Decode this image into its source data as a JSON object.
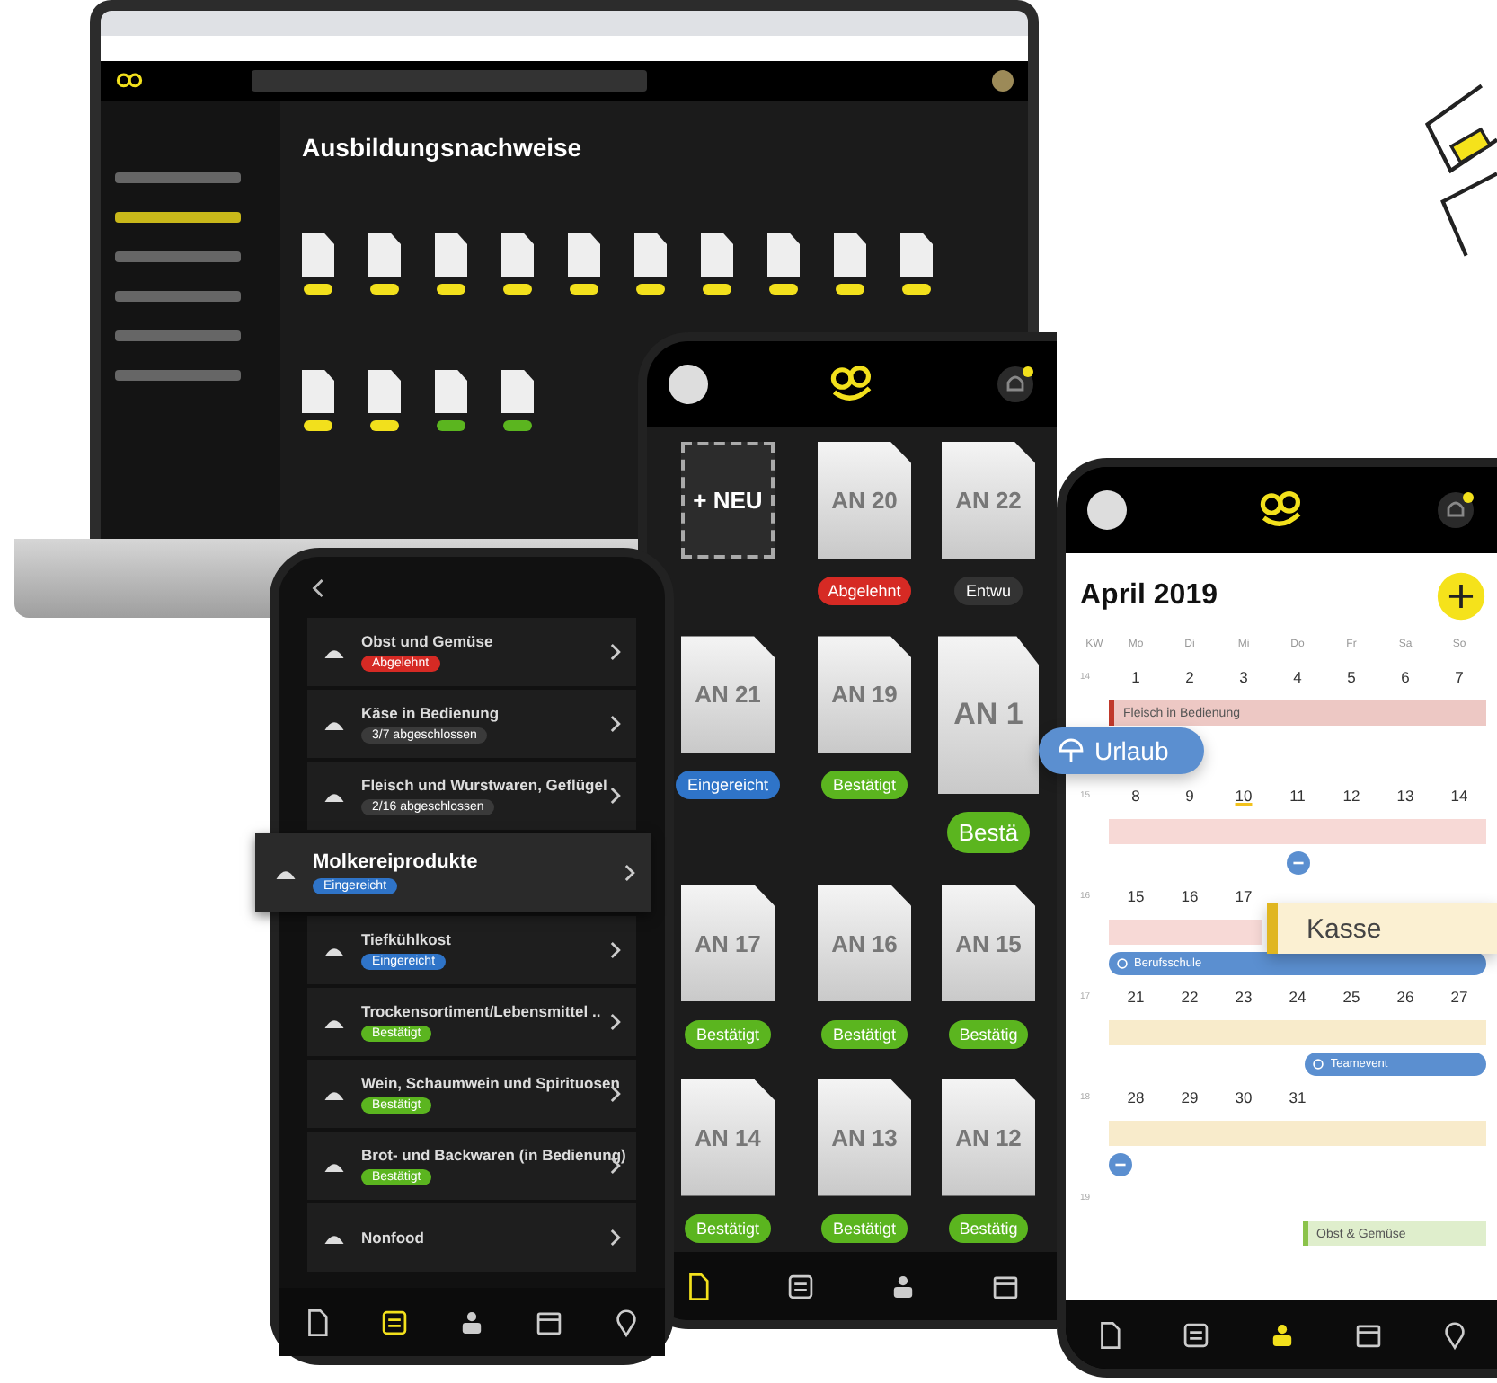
{
  "laptop": {
    "page_title": "Ausbildungsnachweise",
    "sidebar": [
      {
        "selected": false
      },
      {
        "selected": true
      },
      {
        "selected": false
      },
      {
        "selected": false
      },
      {
        "selected": false
      },
      {
        "selected": false
      }
    ],
    "sections": [
      {
        "docs": [
          {
            "color": "#f2e01c"
          },
          {
            "color": "#f2e01c"
          },
          {
            "color": "#f2e01c"
          },
          {
            "color": "#f2e01c"
          },
          {
            "color": "#f2e01c"
          },
          {
            "color": "#f2e01c"
          },
          {
            "color": "#f2e01c"
          },
          {
            "color": "#f2e01c"
          },
          {
            "color": "#f2e01c"
          },
          {
            "color": "#f2e01c"
          }
        ]
      },
      {
        "docs": [
          {
            "color": "#f2e01c"
          },
          {
            "color": "#f2e01c"
          },
          {
            "color": "#5bb51f"
          },
          {
            "color": "#5bb51f"
          }
        ]
      }
    ]
  },
  "list_phone": {
    "items": [
      {
        "title": "Obst und Gemüse",
        "badge": "Abgelehnt",
        "color": "#d62a24",
        "highlighted": false
      },
      {
        "title": "Käse in Bedienung",
        "badge": "3/7 abgeschlossen",
        "color": "#3a3a3a",
        "highlighted": false
      },
      {
        "title": "Fleisch und Wurstwaren, Geflügel",
        "badge": "2/16 abgeschlossen",
        "color": "#3a3a3a",
        "highlighted": false
      },
      {
        "title": "Molkereiprodukte",
        "badge": "Eingereicht",
        "color": "#2f74c8",
        "highlighted": true
      },
      {
        "title": "Tiefkühlkost",
        "badge": "Eingereicht",
        "color": "#2f74c8",
        "highlighted": false
      },
      {
        "title": "Trockensortiment/Lebensmittel ..",
        "badge": "Bestätigt",
        "color": "#5bb51f",
        "highlighted": false
      },
      {
        "title": "Wein, Schaumwein und Spirituosen",
        "badge": "Bestätigt",
        "color": "#5bb51f",
        "highlighted": false
      },
      {
        "title": "Brot- und Backwaren (in Bedienung)",
        "badge": "Bestätigt",
        "color": "#5bb51f",
        "highlighted": false
      },
      {
        "title": "Nonfood",
        "highlighted": false
      }
    ],
    "nav": [
      {
        "kind": "doc",
        "selected": false
      },
      {
        "kind": "list",
        "selected": true
      },
      {
        "kind": "people",
        "selected": false
      },
      {
        "kind": "calendar",
        "selected": false
      },
      {
        "kind": "pin",
        "selected": false
      }
    ]
  },
  "docs_phone": {
    "cards": [
      {
        "kind": "new",
        "label": "+ NEU"
      },
      {
        "kind": "doc",
        "label": "AN 20",
        "badge": "Abgelehnt",
        "color": "#d62a24",
        "enlarged": false
      },
      {
        "kind": "doc",
        "label": "AN 22",
        "badge": "Entwu",
        "color": "#333333",
        "enlarged": false
      },
      {
        "kind": "doc",
        "label": "AN 21",
        "badge": "Eingereicht",
        "color": "#2f74c8",
        "enlarged": false
      },
      {
        "kind": "doc",
        "label": "AN 19",
        "badge": "Bestätigt",
        "color": "#5bb51f",
        "enlarged": false
      },
      {
        "kind": "doc",
        "label": "AN 1",
        "badge": "Bestä",
        "color": "#5bb51f",
        "enlarged": true
      },
      {
        "kind": "doc",
        "label": "AN 17",
        "badge": "Bestätigt",
        "color": "#5bb51f",
        "enlarged": false
      },
      {
        "kind": "doc",
        "label": "AN 16",
        "badge": "Bestätigt",
        "color": "#5bb51f",
        "enlarged": false
      },
      {
        "kind": "doc",
        "label": "AN 15",
        "badge": "Bestätig",
        "color": "#5bb51f",
        "enlarged": false
      },
      {
        "kind": "doc",
        "label": "AN 14",
        "badge": "Bestätigt",
        "color": "#5bb51f",
        "enlarged": false
      },
      {
        "kind": "doc",
        "label": "AN 13",
        "badge": "Bestätigt",
        "color": "#5bb51f",
        "enlarged": false
      },
      {
        "kind": "doc",
        "label": "AN 12",
        "badge": "Bestätig",
        "color": "#5bb51f",
        "enlarged": false
      }
    ],
    "nav": [
      {
        "kind": "doc",
        "selected": true
      },
      {
        "kind": "list",
        "selected": false
      },
      {
        "kind": "people",
        "selected": false
      },
      {
        "kind": "calendar",
        "selected": false
      }
    ]
  },
  "calendar_phone": {
    "title": "April 2019",
    "weekdays": [
      "KW",
      "Mo",
      "Di",
      "Mi",
      "Do",
      "Fr",
      "Sa",
      "So"
    ],
    "weeks": [
      {
        "kw": "14",
        "days": [
          {
            "label": "1",
            "today": false
          },
          {
            "label": "2",
            "today": false
          },
          {
            "label": "3",
            "today": false
          },
          {
            "label": "4",
            "today": false
          },
          {
            "label": "5",
            "today": false
          },
          {
            "label": "6",
            "today": false
          },
          {
            "label": "7",
            "today": false
          }
        ],
        "events": [
          {
            "kind": "bar",
            "label": "Fleisch in Bedienung",
            "color": "#c0392b"
          }
        ]
      },
      {
        "kw": "15",
        "days": [
          {
            "label": "8",
            "today": false
          },
          {
            "label": "9",
            "today": false
          },
          {
            "label": "10",
            "today": true
          },
          {
            "label": "11",
            "today": false
          },
          {
            "label": "12",
            "today": false
          },
          {
            "label": "13",
            "today": false
          },
          {
            "label": "14",
            "today": false
          }
        ],
        "events": [
          {
            "kind": "bar",
            "color": "#f7d9d6"
          },
          {
            "kind": "dot-center",
            "color": "#5b8fd0"
          }
        ]
      },
      {
        "kw": "16",
        "days": [
          {
            "label": "15",
            "today": false
          },
          {
            "label": "16",
            "today": false
          },
          {
            "label": "17",
            "today": false
          }
        ],
        "events": [
          {
            "kind": "bar-start",
            "color": "#f7d9d6"
          },
          {
            "kind": "pill",
            "label": "Berufsschule",
            "color": "#5b8fd0"
          }
        ]
      },
      {
        "kw": "17",
        "days": [
          {
            "label": "21",
            "today": false
          },
          {
            "label": "22",
            "today": false
          },
          {
            "label": "23",
            "today": false
          },
          {
            "label": "24",
            "today": false
          },
          {
            "label": "25",
            "today": false
          },
          {
            "label": "26",
            "today": false
          },
          {
            "label": "27",
            "today": false
          }
        ],
        "events": [
          {
            "kind": "bar",
            "color": "#f8ebcb"
          },
          {
            "kind": "pill-end",
            "label": "Teamevent",
            "color": "#5b8fd0"
          }
        ]
      },
      {
        "kw": "18",
        "days": [
          {
            "label": "28",
            "today": false
          },
          {
            "label": "29",
            "today": false
          },
          {
            "label": "30",
            "today": false
          },
          {
            "label": "31",
            "today": false
          }
        ],
        "events": [
          {
            "kind": "bar",
            "color": "#f8ebcb"
          },
          {
            "kind": "dot",
            "color": "#5b8fd0"
          }
        ]
      },
      {
        "kw": "19",
        "events": [
          {
            "kind": "bar-end",
            "label": "Obst & Gemüse",
            "color": "#8bc34a"
          }
        ]
      }
    ],
    "floating": [
      {
        "kind": "pill",
        "label": "Urlaub"
      },
      {
        "kind": "card",
        "label": "Kasse"
      }
    ],
    "nav": [
      {
        "kind": "doc",
        "selected": false
      },
      {
        "kind": "list",
        "selected": false
      },
      {
        "kind": "people",
        "selected": true
      },
      {
        "kind": "calendar",
        "selected": false
      },
      {
        "kind": "pin",
        "selected": false
      }
    ]
  }
}
